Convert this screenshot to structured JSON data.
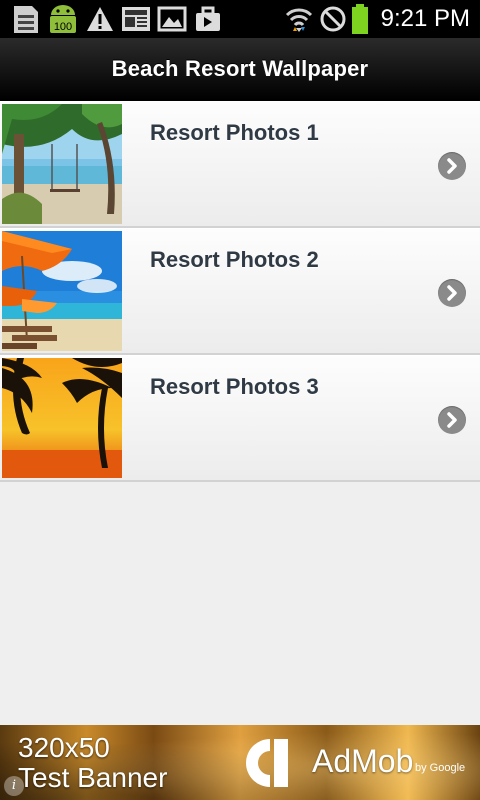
{
  "status_bar": {
    "time": "9:21 PM",
    "icons": [
      "sd-card-icon",
      "android-battery-100-icon",
      "warning-icon",
      "news-icon",
      "image-icon",
      "briefcase-icon",
      "wifi-icon",
      "no-signal-icon",
      "battery-icon"
    ],
    "battery_badge": "100",
    "battery_color": "#7ed321"
  },
  "header": {
    "title": "Beach Resort Wallpaper"
  },
  "list": {
    "items": [
      {
        "label": "Resort Photos 1",
        "thumbnail": "beach-swing-photo"
      },
      {
        "label": "Resort Photos 2",
        "thumbnail": "beach-umbrella-photo"
      },
      {
        "label": "Resort Photos 3",
        "thumbnail": "palm-sunset-photo"
      }
    ]
  },
  "ad": {
    "size": "320x50",
    "subtitle": "Test Banner",
    "brand": "AdMob",
    "by": "by Google",
    "info": "i"
  }
}
